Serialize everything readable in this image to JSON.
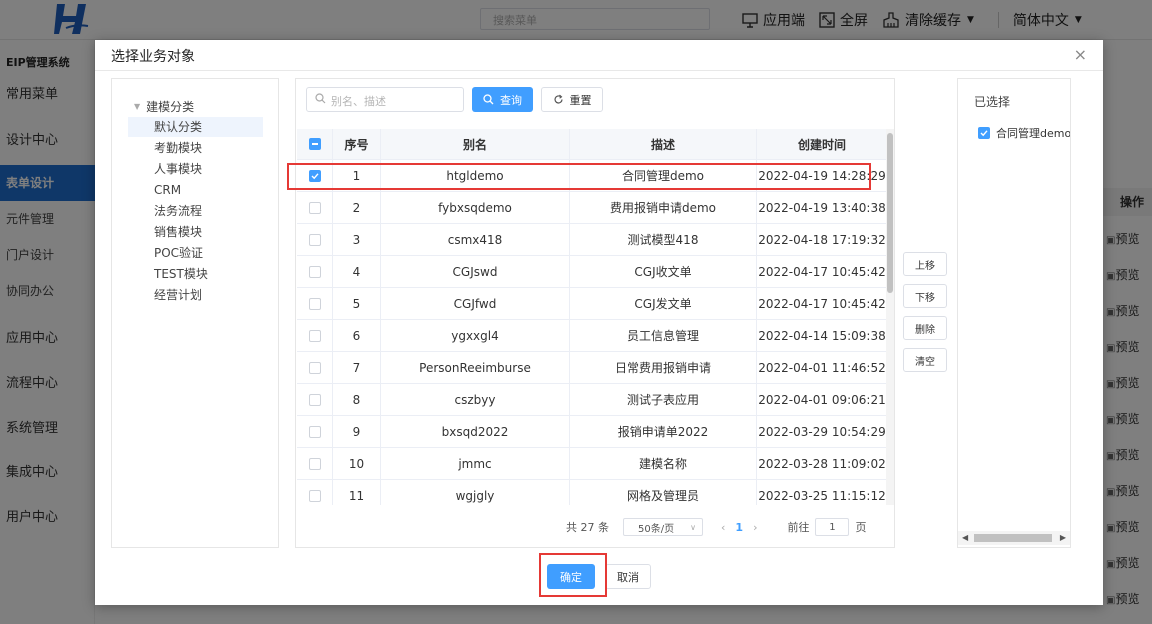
{
  "app": {
    "system_name": "EIP管理系统",
    "menu_search_placeholder": "搜索菜单",
    "top_actions": {
      "app_side": "应用端",
      "fullscreen": "全屏",
      "clear_cache": "清除缓存",
      "language": "简体中文"
    },
    "sidebar": [
      "常用菜单",
      "设计中心",
      "表单设计",
      "元件管理",
      "门户设计",
      "协同办公",
      "应用中心",
      "流程中心",
      "系统管理",
      "集成中心",
      "用户中心"
    ],
    "right_column": {
      "header": "操作",
      "link_label": "预览"
    }
  },
  "dialog": {
    "title": "选择业务对象",
    "close": "×",
    "tree": {
      "root": "建模分类",
      "nodes": [
        "默认分类",
        "考勤模块",
        "人事模块",
        "CRM",
        "法务流程",
        "销售模块",
        "POC验证",
        "TEST模块",
        "经营计划"
      ]
    },
    "search": {
      "placeholder": "别名、描述",
      "query_label": "查询",
      "reset_label": "重置"
    },
    "table": {
      "headers": [
        "序号",
        "别名",
        "描述",
        "创建时间"
      ],
      "rows": [
        {
          "no": "1",
          "alias": "htgldemo",
          "desc": "合同管理demo",
          "time": "2022-04-19 14:28:29",
          "checked": true
        },
        {
          "no": "2",
          "alias": "fybxsqdemo",
          "desc": "费用报销申请demo",
          "time": "2022-04-19 13:40:38",
          "checked": false
        },
        {
          "no": "3",
          "alias": "csmx418",
          "desc": "测试模型418",
          "time": "2022-04-18 17:19:32",
          "checked": false
        },
        {
          "no": "4",
          "alias": "CGJswd",
          "desc": "CGJ收文单",
          "time": "2022-04-17 10:45:42",
          "checked": false
        },
        {
          "no": "5",
          "alias": "CGJfwd",
          "desc": "CGJ发文单",
          "time": "2022-04-17 10:45:42",
          "checked": false
        },
        {
          "no": "6",
          "alias": "ygxxgl4",
          "desc": "员工信息管理",
          "time": "2022-04-14 15:09:38",
          "checked": false
        },
        {
          "no": "7",
          "alias": "PersonReeimburse",
          "desc": "日常费用报销申请",
          "time": "2022-04-01 11:46:52",
          "checked": false
        },
        {
          "no": "8",
          "alias": "cszbyy",
          "desc": "测试子表应用",
          "time": "2022-04-01 09:06:21",
          "checked": false
        },
        {
          "no": "9",
          "alias": "bxsqd2022",
          "desc": "报销申请单2022",
          "time": "2022-03-29 10:54:29",
          "checked": false
        },
        {
          "no": "10",
          "alias": "jmmc",
          "desc": "建模名称",
          "time": "2022-03-28 11:09:02",
          "checked": false
        },
        {
          "no": "11",
          "alias": "wgjgly",
          "desc": "网格及管理员",
          "time": "2022-03-25 11:15:12",
          "checked": false
        }
      ]
    },
    "pagination": {
      "total": "共 27 条",
      "page_size": "50条/页",
      "current_page": "1",
      "goto_label": "前往",
      "goto_value": "1",
      "page_unit": "页"
    },
    "side_buttons": {
      "up": "上移",
      "down": "下移",
      "delete": "删除",
      "clear": "清空"
    },
    "selected": {
      "title": "已选择",
      "items": [
        "合同管理demo"
      ]
    },
    "footer": {
      "confirm": "确定",
      "cancel": "取消"
    }
  },
  "colors": {
    "primary": "#409eff",
    "highlight": "#e53935",
    "sidebar_active": "#1f6fd1",
    "logo": "#1f5fbf"
  }
}
